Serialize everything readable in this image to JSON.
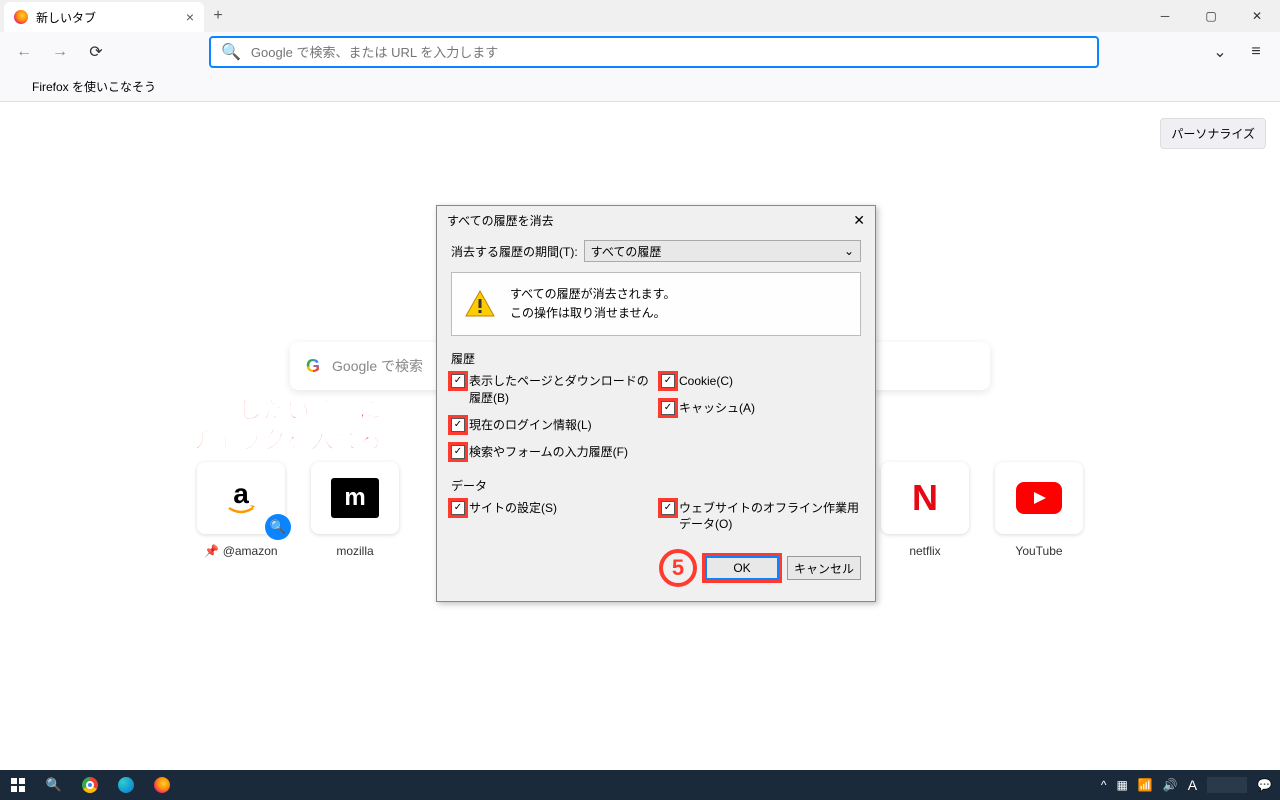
{
  "titlebar": {
    "tab_label": "新しいタブ"
  },
  "urlbar": {
    "placeholder": "Google で検索、または URL を入力します"
  },
  "bookmarks": {
    "item1": "Firefox を使いこなそう"
  },
  "content": {
    "personalize": "パーソナライズ",
    "centersearch_placeholder": "Google で検索",
    "tiles": [
      {
        "label": "@amazon",
        "pinned": true
      },
      {
        "label": "mozilla"
      },
      {
        "label": "netflix"
      },
      {
        "label": "YouTube"
      }
    ]
  },
  "annotation": {
    "line1": "削除したい項目に",
    "line2": "チェックを入れる",
    "step": "5"
  },
  "dialog": {
    "title": "すべての履歴を消去",
    "range_label": "消去する履歴の期間(T):",
    "range_value": "すべての履歴",
    "warning_line1": "すべての履歴が消去されます。",
    "warning_line2": "この操作は取り消せません。",
    "section_history": "履歴",
    "chk_browsing": "表示したページとダウンロードの履歴(B)",
    "chk_logins": "現在のログイン情報(L)",
    "chk_forms": "検索やフォームの入力履歴(F)",
    "chk_cookies": "Cookie(C)",
    "chk_cache": "キャッシュ(A)",
    "section_data": "データ",
    "chk_sitesettings": "サイトの設定(S)",
    "chk_offline": "ウェブサイトのオフライン作業用データ(O)",
    "btn_ok": "OK",
    "btn_cancel": "キャンセル"
  },
  "taskbar": {
    "lang": "A"
  }
}
